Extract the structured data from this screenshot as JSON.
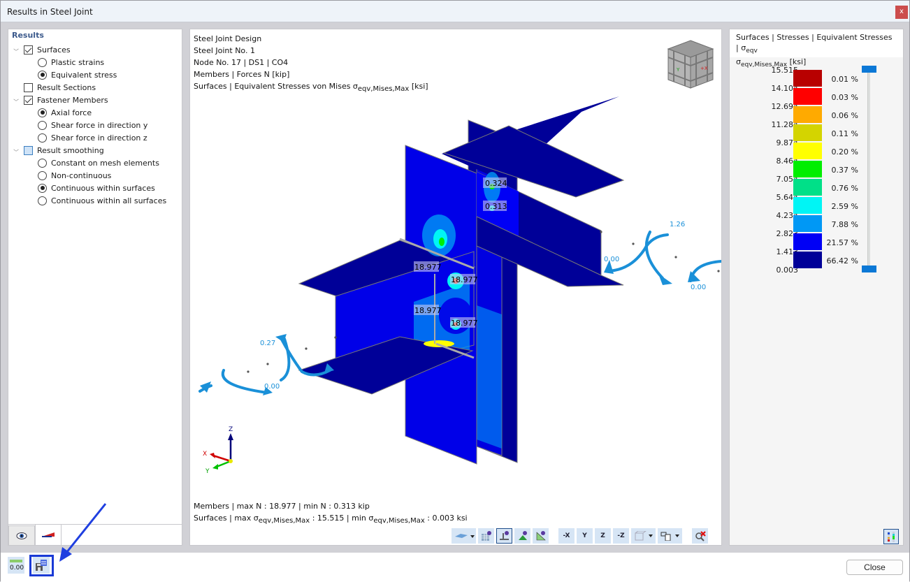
{
  "window": {
    "title": "Results in Steel Joint",
    "close_glyph": "x"
  },
  "tree": {
    "heading": "Results",
    "items": [
      {
        "type": "checkbox",
        "label": "Surfaces",
        "checked": true,
        "expanded": true,
        "level": 0
      },
      {
        "type": "radio",
        "label": "Plastic strains",
        "selected": false,
        "level": 1
      },
      {
        "type": "radio",
        "label": "Equivalent stress",
        "selected": true,
        "level": 1
      },
      {
        "type": "checkbox",
        "label": "Result Sections",
        "checked": false,
        "expanded": false,
        "level": 0
      },
      {
        "type": "checkbox",
        "label": "Fastener Members",
        "checked": true,
        "expanded": true,
        "level": 0
      },
      {
        "type": "radio",
        "label": "Axial force",
        "selected": true,
        "level": 1
      },
      {
        "type": "radio",
        "label": "Shear force in direction y",
        "selected": false,
        "level": 1
      },
      {
        "type": "radio",
        "label": "Shear force in direction z",
        "selected": false,
        "level": 1
      },
      {
        "type": "checkbox",
        "label": "Result smoothing",
        "checked": "partial",
        "expanded": true,
        "level": 0
      },
      {
        "type": "radio",
        "label": "Constant on mesh elements",
        "selected": false,
        "level": 1
      },
      {
        "type": "radio",
        "label": "Non-continuous",
        "selected": false,
        "level": 1
      },
      {
        "type": "radio",
        "label": "Continuous within surfaces",
        "selected": true,
        "level": 1
      },
      {
        "type": "radio",
        "label": "Continuous within all surfaces",
        "selected": false,
        "level": 1
      }
    ],
    "tabs": [
      {
        "icon": "eye-icon",
        "active": false
      },
      {
        "icon": "color-scale-icon",
        "active": true
      }
    ]
  },
  "viewport": {
    "info": {
      "line1": "Steel Joint Design",
      "line2": "Steel Joint No. 1",
      "line3": "Node No. 17 | DS1 | CO4",
      "line4": "Members | Forces N [kip]",
      "line5_prefix": "Surfaces | Equivalent Stresses von Mises σ",
      "line5_sub": "eqv,Mises,Max",
      "line5_suffix": " [ksi]"
    },
    "labels": {
      "member_values": [
        "0.324",
        "0.313",
        "18.977",
        "18.977",
        "18.977",
        "18.977"
      ],
      "moment_values": [
        "1.26",
        "0.00",
        "0.00",
        "0.27",
        "0.00"
      ]
    },
    "axes": {
      "x": "X",
      "y": "Y",
      "z": "Z"
    },
    "footer": {
      "line1": "Members | max N : 18.977 | min N : 0.313 kip",
      "line2_a": "Surfaces | max σ",
      "line2_sub1": "eqv,Mises,Max",
      "line2_b": " : 15.515 | min σ",
      "line2_sub2": "eqv,Mises,Max",
      "line2_c": " : 0.003 ksi"
    },
    "toolbar": [
      {
        "name": "display-surfaces-dropdown",
        "icon": "surface-icon",
        "dropdown": true
      },
      {
        "name": "mesh-view-button",
        "icon": "mesh-eye-icon"
      },
      {
        "name": "support-view-button",
        "icon": "support-eye-icon",
        "active": true
      },
      {
        "name": "load-view-button",
        "icon": "load-eye-icon"
      },
      {
        "name": "dimension-view-button",
        "icon": "dimension-eye-icon"
      },
      {
        "name": "view-minus-x-button",
        "icon": "view-x-icon",
        "label": "-X"
      },
      {
        "name": "view-y-button",
        "icon": "view-y-icon",
        "label": "Y"
      },
      {
        "name": "view-z-button",
        "icon": "view-z-icon",
        "label": "Z"
      },
      {
        "name": "view-minus-z-button",
        "icon": "view-minus-z-icon",
        "label": "-Z"
      },
      {
        "name": "render-mode-dropdown",
        "icon": "box-icon",
        "dropdown": true
      },
      {
        "name": "print-dropdown",
        "icon": "print-icon",
        "dropdown": true
      },
      {
        "name": "reset-view-button",
        "icon": "zoom-reset-icon"
      }
    ]
  },
  "legend": {
    "title_line1": "Surfaces | Stresses | Equivalent Stresses | σ",
    "title_line1_sub": "eqv",
    "title_line2_sigma": "σ",
    "title_line2_sub": "eqv,Mises,Max",
    "title_line2_unit": " [ksi]",
    "values": [
      "15.515",
      "14.104",
      "12.694",
      "11.284",
      "9.874",
      "8.464",
      "7.054",
      "5.644",
      "4.234",
      "2.823",
      "1.413",
      "0.003"
    ],
    "bands": [
      {
        "color": "#b80000",
        "percent": "0.01 %"
      },
      {
        "color": "#ff0000",
        "percent": "0.03 %"
      },
      {
        "color": "#ffaa00",
        "percent": "0.06 %"
      },
      {
        "color": "#d4d400",
        "percent": "0.11 %"
      },
      {
        "color": "#ffff00",
        "percent": "0.20 %"
      },
      {
        "color": "#00ee00",
        "percent": "0.37 %"
      },
      {
        "color": "#00e088",
        "percent": "0.76 %"
      },
      {
        "color": "#00f5f5",
        "percent": "2.59 %"
      },
      {
        "color": "#0098f5",
        "percent": "7.88 %"
      },
      {
        "color": "#0000f5",
        "percent": "21.57 %"
      },
      {
        "color": "#000098",
        "percent": "66.42 %"
      }
    ]
  },
  "bottom": {
    "decimal_button_label": "0.00",
    "close_label": "Close"
  }
}
